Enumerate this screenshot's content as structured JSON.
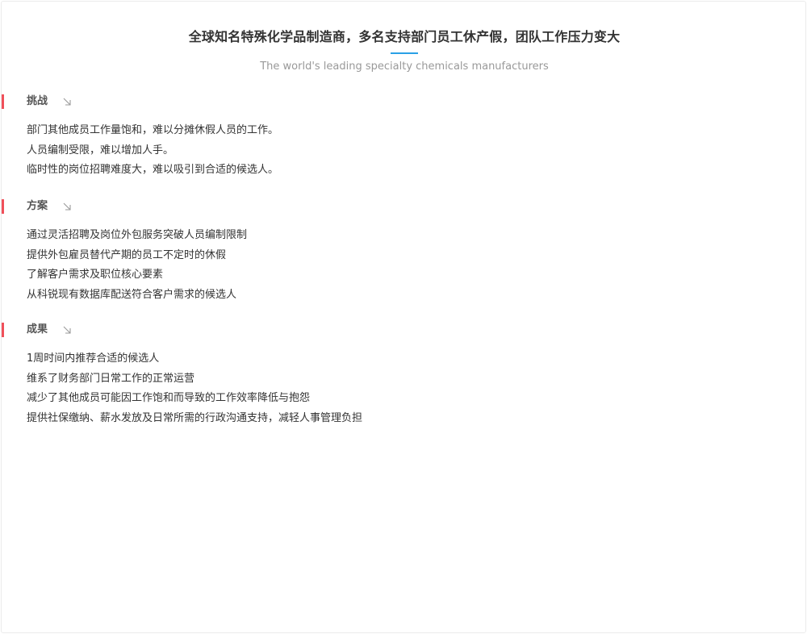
{
  "header": {
    "title": "全球知名特殊化学品制造商，多名支持部门员工休产假，团队工作压力变大",
    "subtitle": "The world's leading specialty chemicals manufacturers",
    "accent_color": "#2aa0e6"
  },
  "sections": [
    {
      "title": "挑战",
      "icon": "arrow-down-right-icon",
      "items": [
        "部门其他成员工作量饱和，难以分摊休假人员的工作。",
        "人员编制受限，难以增加人手。",
        "临时性的岗位招聘难度大，难以吸引到合适的候选人。"
      ]
    },
    {
      "title": "方案",
      "icon": "arrow-down-right-icon",
      "items": [
        "通过灵活招聘及岗位外包服务突破人员编制限制",
        "提供外包雇员替代产期的员工不定时的休假",
        "了解客户需求及职位核心要素",
        "从科锐现有数据库配送符合客户需求的候选人"
      ]
    },
    {
      "title": "成果",
      "icon": "arrow-down-right-icon",
      "items": [
        "1周时间内推荐合适的候选人",
        "维系了财务部门日常工作的正常运营",
        "减少了其他成员可能因工作饱和而导致的工作效率降低与抱怨",
        "提供社保缴纳、薪水发放及日常所需的行政沟通支持，减轻人事管理负担"
      ]
    }
  ],
  "colors": {
    "section_marker": "#f0505a",
    "body_text": "#333333",
    "subtitle_text": "#999999"
  }
}
